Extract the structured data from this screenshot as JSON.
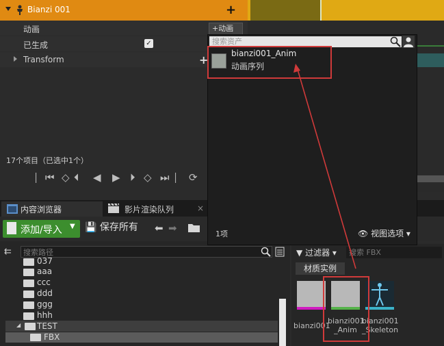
{
  "sequencer": {
    "track_title": "Bianzi 001",
    "rows": {
      "animation": "动画",
      "baked": "已生成",
      "transform": "Transform"
    },
    "add_animation_label": "+动画",
    "items_count": "17个项目（已选中1个）"
  },
  "asset_picker": {
    "search_placeholder": "搜索资产",
    "asset_name": "bianzi001_Anim",
    "asset_type": "动画序列",
    "count": "1项",
    "view_options": "视图选项"
  },
  "tabs": {
    "content_browser": "内容浏览器",
    "render_queue": "影片渲染队列"
  },
  "toolbar": {
    "add_import": "添加/导入",
    "save_all": "保存所有"
  },
  "path_panel": {
    "search_placeholder": "搜索路径",
    "folders": [
      "037",
      "aaa",
      "ccc",
      "ddd",
      "ggg",
      "hhh",
      "TEST",
      "FBX"
    ]
  },
  "asset_panel": {
    "filter_label": "过滤器",
    "search_placeholder": "搜索 FBX",
    "category": "材质实例",
    "assets": [
      {
        "label": "bianzi001",
        "label2": ""
      },
      {
        "label": "bianzi001",
        "label2": "_Anim"
      },
      {
        "label": "bianzi001",
        "label2": "_Skeleton"
      }
    ]
  },
  "colors": {
    "track_header": "#e08a12",
    "add_button": "#3c8e2e",
    "annotation": "#d03a3a"
  }
}
